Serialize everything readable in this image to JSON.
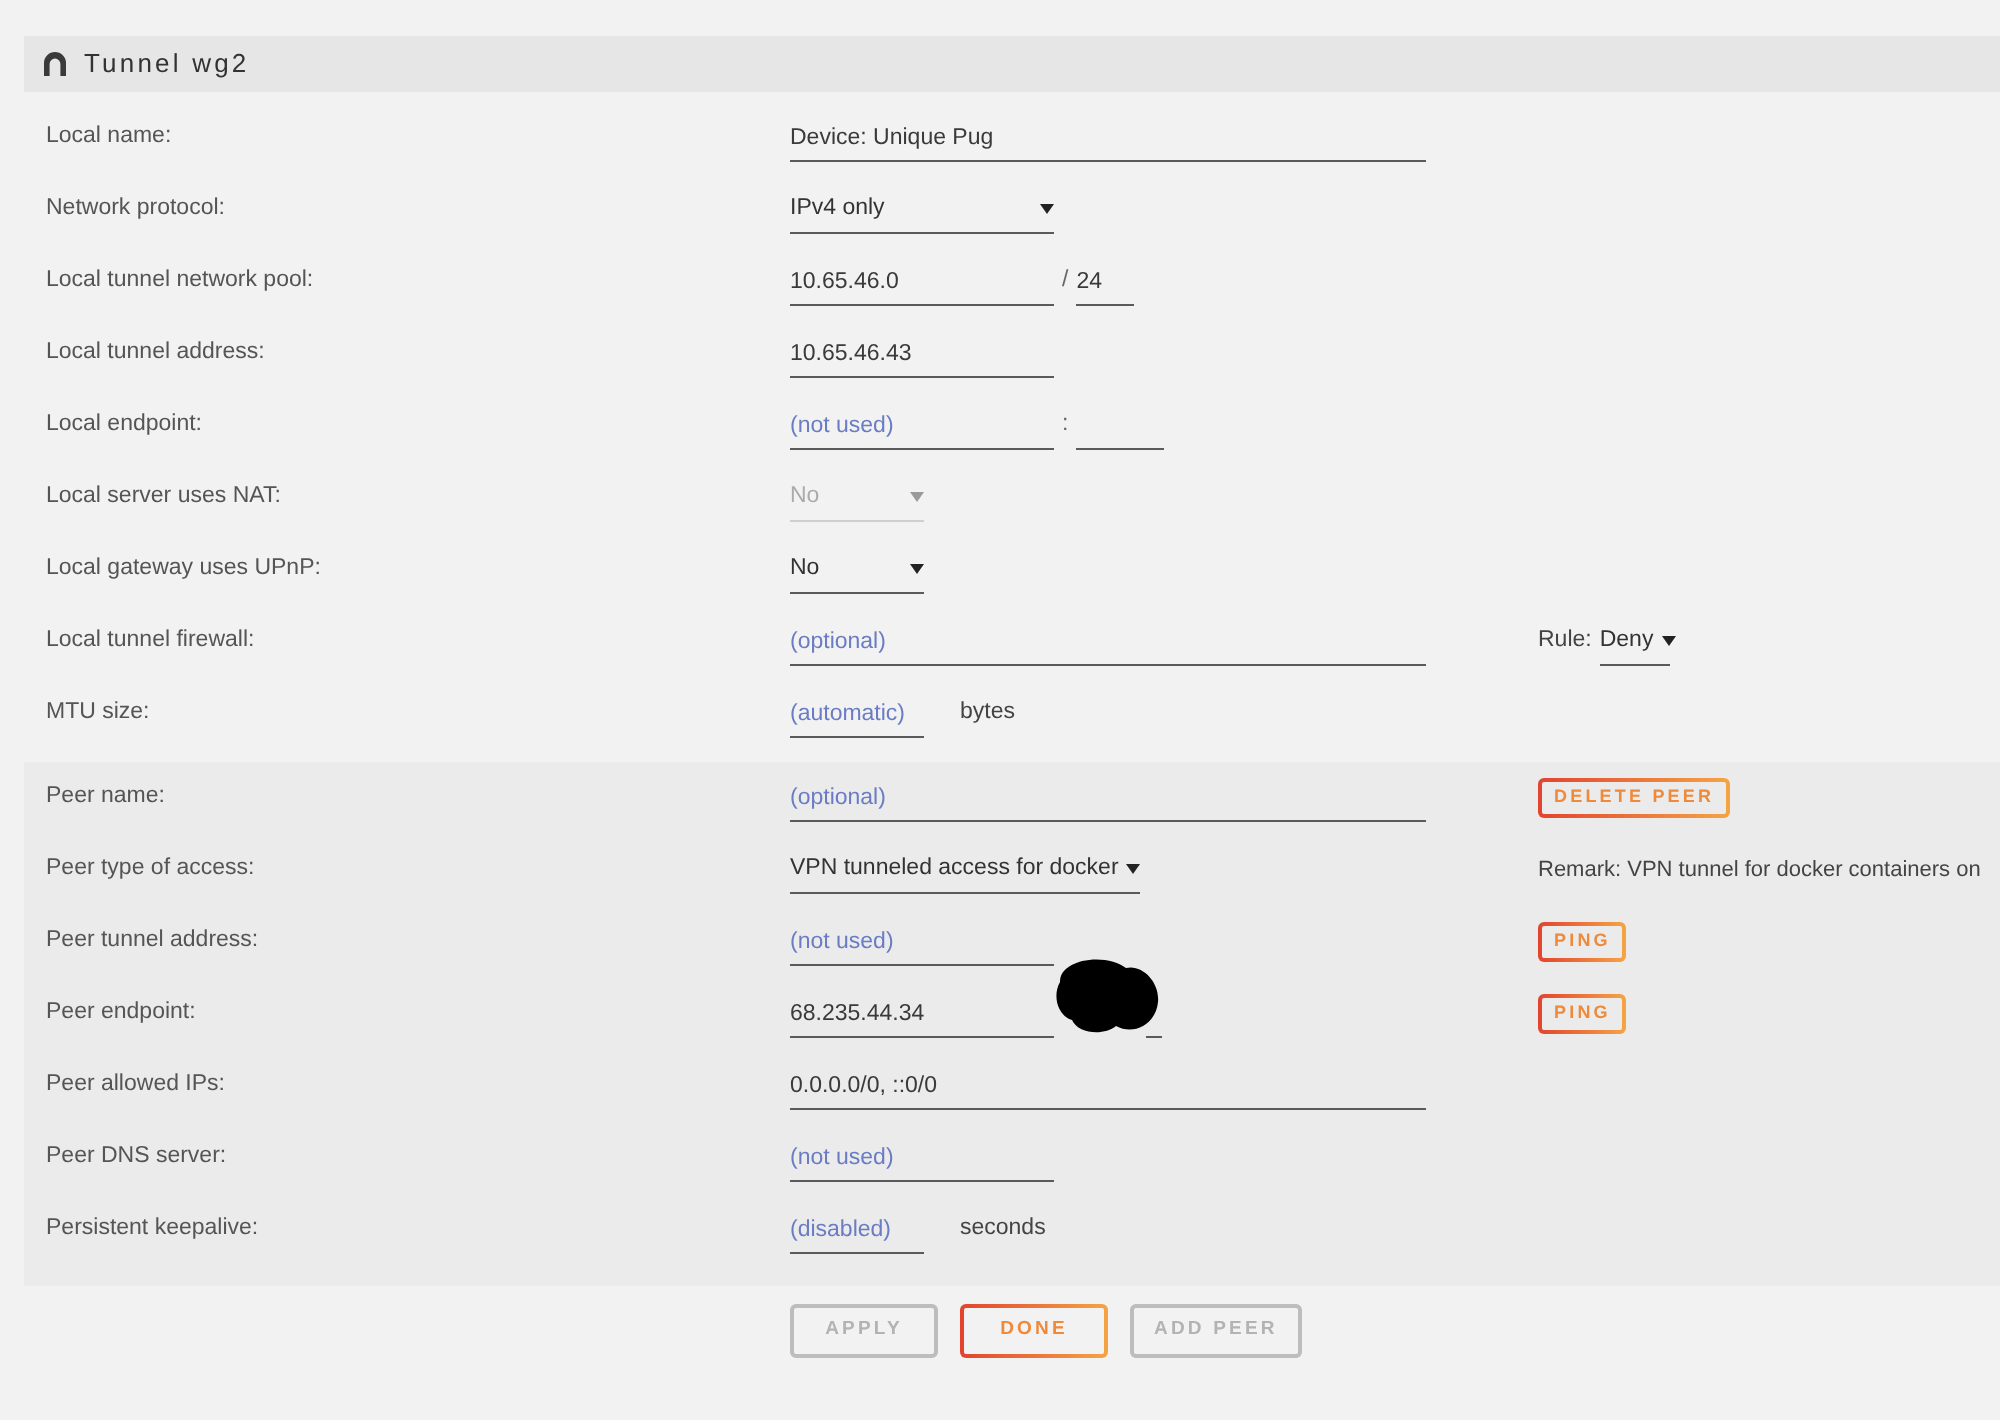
{
  "panel": {
    "title": "Tunnel wg2"
  },
  "local_settings": [
    {
      "label": "Local name:",
      "kind": "text",
      "value": "Device: Unique Pug"
    },
    {
      "label": "Network protocol:",
      "kind": "select",
      "value": "IPv4 only",
      "disabled": false
    },
    {
      "label": "Local tunnel network pool:",
      "kind": "address_prefix",
      "value": "10.65.46.0",
      "separator": "/",
      "suffix_value": "24"
    },
    {
      "label": "Local tunnel address:",
      "kind": "address",
      "value": "10.65.46.43"
    },
    {
      "label": "Local endpoint:",
      "kind": "address_port",
      "placeholder": "(not used)",
      "separator": ":"
    },
    {
      "label": "Local server uses NAT:",
      "kind": "select",
      "value": "No",
      "disabled": true
    },
    {
      "label": "Local gateway uses UPnP:",
      "kind": "select",
      "value": "No",
      "disabled": false
    },
    {
      "label": "Local tunnel firewall:",
      "kind": "text",
      "placeholder": "(optional)",
      "aside": {
        "kind": "select",
        "label": "Rule:",
        "value": "Deny"
      }
    },
    {
      "label": "MTU size:",
      "kind": "number",
      "placeholder": "(automatic)",
      "unit": "bytes"
    }
  ],
  "peer_settings": [
    {
      "label": "Peer name:",
      "kind": "text",
      "placeholder": "(optional)",
      "aside": {
        "kind": "button",
        "label": "DELETE PEER"
      }
    },
    {
      "label": "Peer type of access:",
      "kind": "select",
      "value": "VPN tunneled access for docker",
      "disabled": false,
      "aside": {
        "kind": "remark",
        "text": "Remark: VPN tunnel for docker containers on"
      }
    },
    {
      "label": "Peer tunnel address:",
      "kind": "address",
      "placeholder": "(not used)",
      "aside": {
        "kind": "button",
        "label": "PING"
      }
    },
    {
      "label": "Peer endpoint:",
      "kind": "address_port",
      "value": "68.235.44.34",
      "redacted": true,
      "aside": {
        "kind": "button",
        "label": "PING"
      }
    },
    {
      "label": "Peer allowed IPs:",
      "kind": "text",
      "value": "0.0.0.0/0, ::0/0"
    },
    {
      "label": "Peer DNS server:",
      "kind": "address",
      "placeholder": "(not used)"
    },
    {
      "label": "Persistent keepalive:",
      "kind": "number",
      "placeholder": "(disabled)",
      "unit": "seconds"
    }
  ],
  "buttons": [
    {
      "label": "APPLY",
      "disabled": true
    },
    {
      "label": "DONE",
      "disabled": false
    },
    {
      "label": "ADD PEER",
      "disabled": true
    }
  ]
}
